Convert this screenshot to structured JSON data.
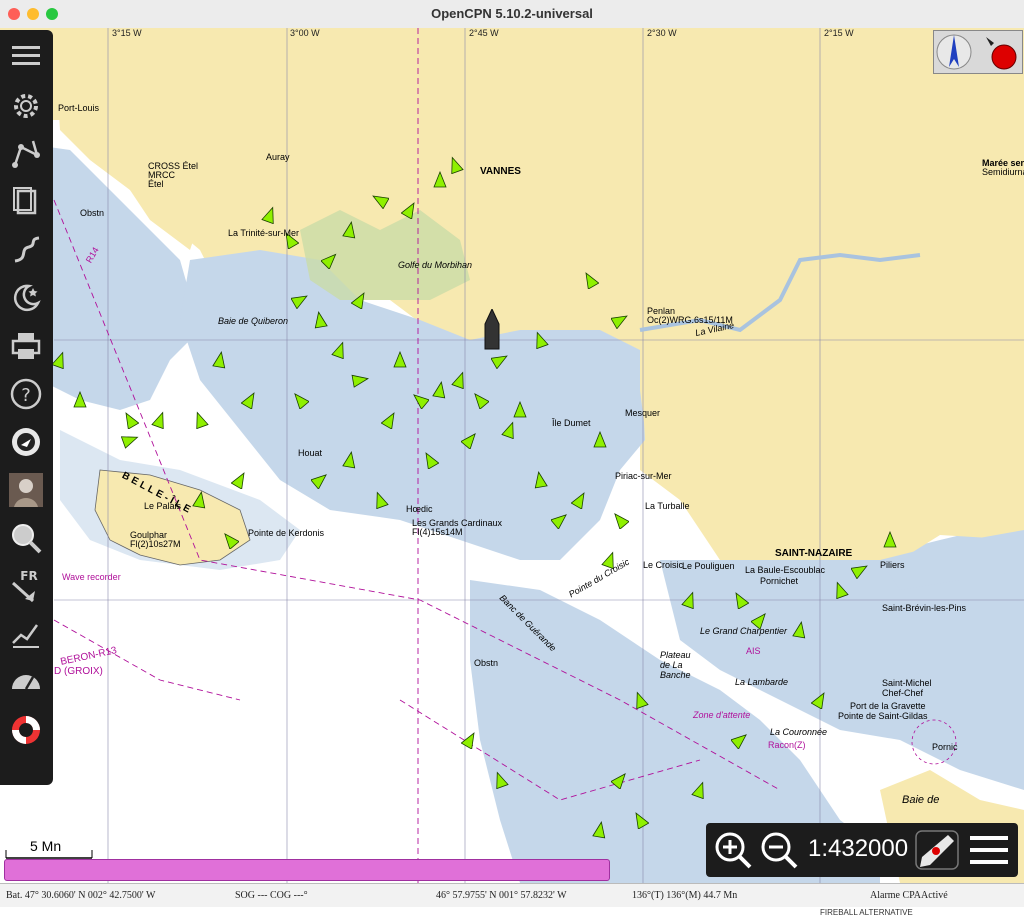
{
  "window": {
    "title": "OpenCPN 5.10.2-universal"
  },
  "colors": {
    "land": "#f7e9b0",
    "shallow": "#c5d7ea",
    "deep": "#ffffff",
    "ais_green": "#8ff000",
    "magenta": "#b0109a"
  },
  "graticule": {
    "lon1": "3°15 W",
    "lon2": "3°00 W",
    "lon3": "2°45 W",
    "lon4": "2°30 W",
    "lon5": "2°15 W"
  },
  "labels": {
    "vannes": "VANNES",
    "saint_nazaire": "SAINT-NAZAIRE",
    "belle_ile": "BELLE-ÎLE",
    "golfe": "Golfe du Morbihan",
    "baie_quiberon": "Baie de Quiberon",
    "cross_etel": "CROSS Étel",
    "mrcc": "MRCC",
    "etel": "Étel",
    "auray": "Auray",
    "trinite": "La Trinité-sur-Mer",
    "penlan": "Penlan",
    "penlan_light": "Oc(2)WRG.6s15/11M",
    "vilaine": "La Vilaine",
    "houat": "Houat",
    "hoedic": "Hœdic",
    "grands_cardinaux": "Les Grands Cardinaux",
    "grands_cardinaux_light": "Fl(4)15s14M",
    "le_palais": "Le Palais",
    "goulphar": "Goulphar",
    "goulphar_light": "Fl(2)10s27M",
    "kerdonis": "Pointe de Kerdonis",
    "banc_guerande": "Banc de Guérande",
    "le_croisic": "Le Croisic",
    "pointe_croisic": "Pointe du Croisic",
    "la_turballe": "La Turballe",
    "piriac": "Piriac-sur-Mer",
    "le_pouliguen": "Le Pouliguen",
    "la_baule": "La Baule-Escoublac",
    "pornichet": "Pornichet",
    "grand_charpentier": "Le Grand Charpentier",
    "plateau_banche": "Plateau de La Banche",
    "la_lambarde": "La Lambarde",
    "la_couronnee": "La Couronnée",
    "saint_gildas": "Pointe de Saint-Gildas",
    "port_gravette": "Port de la Gravette",
    "saint_michel": "Saint-Michel Chef-Chef",
    "saint_brevin": "Saint-Brévin-les-Pins",
    "pornic": "Pornic",
    "baie_de": "Baie de",
    "port_louis": "Port-Louis",
    "mesquer": "Mesquer",
    "ile_dumet": "Île Dumet",
    "maree": "Marée sen",
    "maree2": "Semidiurnal",
    "piliers": "Piliers",
    "zone_attente": "Zone d'attente",
    "groix": "D (GROIX)",
    "quiberon_r13": "BERON-R13",
    "r14": "R14",
    "obstn": "Obstn",
    "ais": "AIS",
    "racon": "Racon(Z)",
    "wave_recorder": "Wave recorder"
  },
  "toolbar": {
    "items": [
      {
        "name": "menu"
      },
      {
        "name": "settings"
      },
      {
        "name": "route"
      },
      {
        "name": "route-manager"
      },
      {
        "name": "tracks"
      },
      {
        "name": "moon"
      },
      {
        "name": "print"
      },
      {
        "name": "help"
      },
      {
        "name": "ais"
      },
      {
        "name": "avatar"
      },
      {
        "name": "search"
      },
      {
        "name": "fr-language"
      },
      {
        "name": "tides"
      },
      {
        "name": "dashboard"
      },
      {
        "name": "lifebuoy"
      }
    ],
    "fr_label": "FR"
  },
  "scale": {
    "bar_label": "5 Mn",
    "ratio": "1:432000"
  },
  "status": {
    "boat_pos": "Bat. 47° 30.6060' N   002° 42.7500' W",
    "sog_cog": "SOG --- COG ---°",
    "cursor_pos": "46° 57.9755' N   001° 57.8232' W",
    "bearing": "136°(T)  136°(M)  44.7 Mn",
    "cpa_alarm": "Alarme CPAActivé"
  },
  "footer_partial": "FIREBALL ALTERNATIVE"
}
